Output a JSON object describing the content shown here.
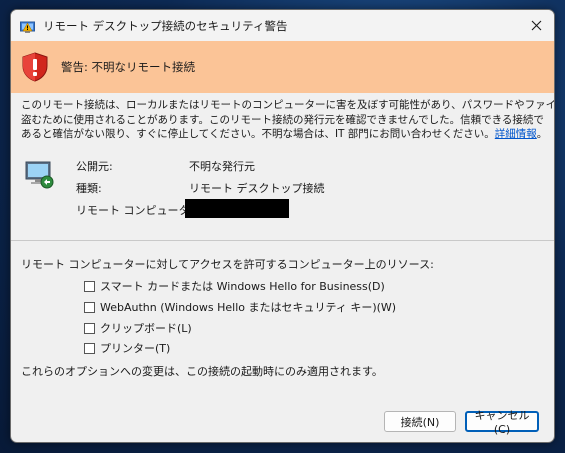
{
  "window": {
    "title": "リモート デスクトップ接続のセキュリティ警告"
  },
  "warning": {
    "text": "警告: 不明なリモート接続",
    "color": "#fbc497"
  },
  "description": {
    "lines": [
      "このリモート接続は、ローカルまたはリモートのコンピューターに害を及ぼす可能性があり、パスワードやファイルを",
      "盗むために使用されることがあります。このリモート接続の発行元を確認できませんでした。信頼できる接続で",
      "あると確信がない限り、すぐに停止してください。不明な場合は、IT 部門にお問い合わせください。"
    ],
    "link": "詳細情報",
    "end": "。"
  },
  "info": {
    "publisher_label": "公開元:",
    "publisher_value": "不明な発行元",
    "type_label": "種類:",
    "type_value": "リモート デスクトップ接続",
    "remote_label": "リモート コンピューター:"
  },
  "resources": {
    "heading": "リモート コンピューターに対してアクセスを許可するコンピューター上のリソース:",
    "options": [
      {
        "label": "スマート カードまたは Windows Hello for Business(D)",
        "checked": false
      },
      {
        "label": "WebAuthn (Windows Hello またはセキュリティ キー)(W)",
        "checked": false
      },
      {
        "label": "クリップボード(L)",
        "checked": false
      },
      {
        "label": "プリンター(T)",
        "checked": false
      }
    ]
  },
  "note": "これらのオプションへの変更は、この接続の起動時にのみ適用されます。",
  "buttons": {
    "connect": "接続(N)",
    "cancel": "キャンセル(C)"
  },
  "icons": {
    "title": "rdp-warning-icon",
    "warning": "shield-warning-icon",
    "computer": "remote-computer-icon",
    "close": "close-icon"
  }
}
